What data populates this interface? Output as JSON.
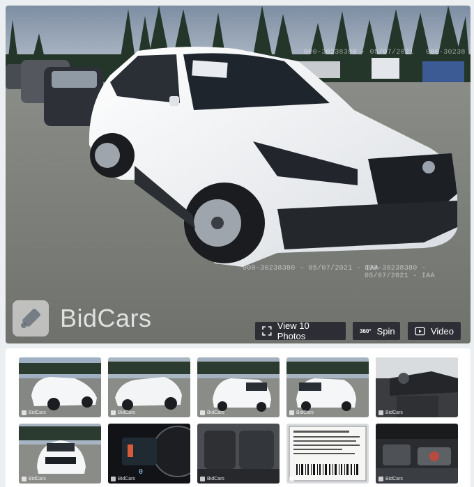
{
  "brand": {
    "name": "BidCars"
  },
  "watermarks": [
    "000-30238380 - 05/07/2021",
    "000-30238380 - 05/07/2021 - IAA",
    "000-30238380 - 05/07/2021 - IAA"
  ],
  "actions": {
    "photos_label": "View 10 Photos",
    "spin_badge": "360°",
    "spin_label": "Spin",
    "video_label": "Video"
  },
  "thumbnails": [
    {
      "label": "BidCars",
      "subject": "white-suv-front-left"
    },
    {
      "label": "BidCars",
      "subject": "white-suv-front-right"
    },
    {
      "label": "BidCars",
      "subject": "white-suv-rear-left"
    },
    {
      "label": "BidCars",
      "subject": "white-suv-rear-right"
    },
    {
      "label": "BidCars",
      "subject": "interior-dashboard"
    },
    {
      "label": "BidCars",
      "subject": "white-suv-front"
    },
    {
      "label": "BidCars",
      "subject": "instrument-cluster"
    },
    {
      "label": "BidCars",
      "subject": "rear-seats"
    },
    {
      "label": "BidCars",
      "subject": "vin-label"
    },
    {
      "label": "BidCars",
      "subject": "engine-bay"
    }
  ],
  "colors": {
    "accent_overlay": "#1e2028",
    "background": "#eceff1"
  }
}
